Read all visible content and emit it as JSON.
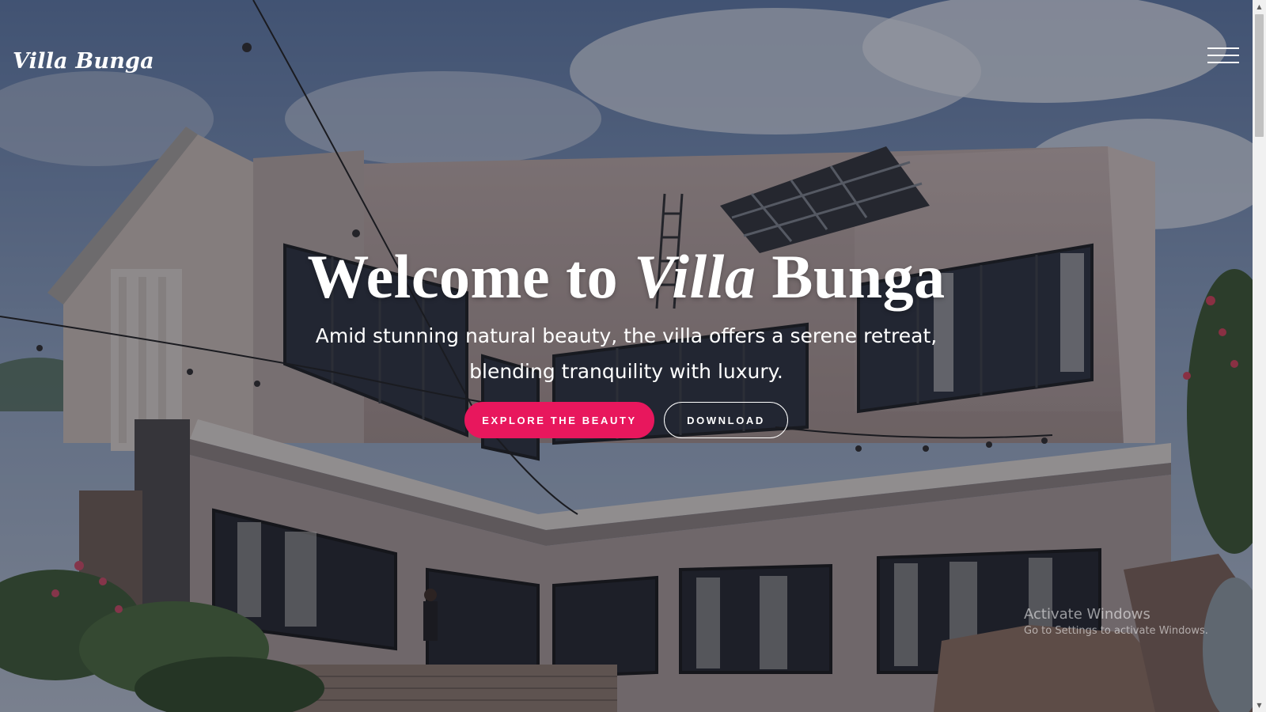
{
  "navbar": {
    "brand": "Villa Bunga",
    "menu_icon": "hamburger-menu-icon"
  },
  "hero": {
    "title_part1": "Welcome to ",
    "title_accent": "Villa",
    "title_part2": " Bunga",
    "subtitle": "Amid stunning natural beauty, the villa offers a serene retreat, blending tranquility with luxury.",
    "primary_button": "EXPLORE THE BEAUTY",
    "secondary_button": "DOWNLOAD",
    "background": "villa-building-photo"
  },
  "colors": {
    "accent": "#e8175d",
    "text": "#ffffff"
  },
  "watermark": {
    "title": "Activate Windows",
    "subtitle": "Go to Settings to activate Windows."
  },
  "scrollbar": {
    "up_icon": "scroll-up-arrow-icon",
    "down_icon": "scroll-down-arrow-icon"
  }
}
